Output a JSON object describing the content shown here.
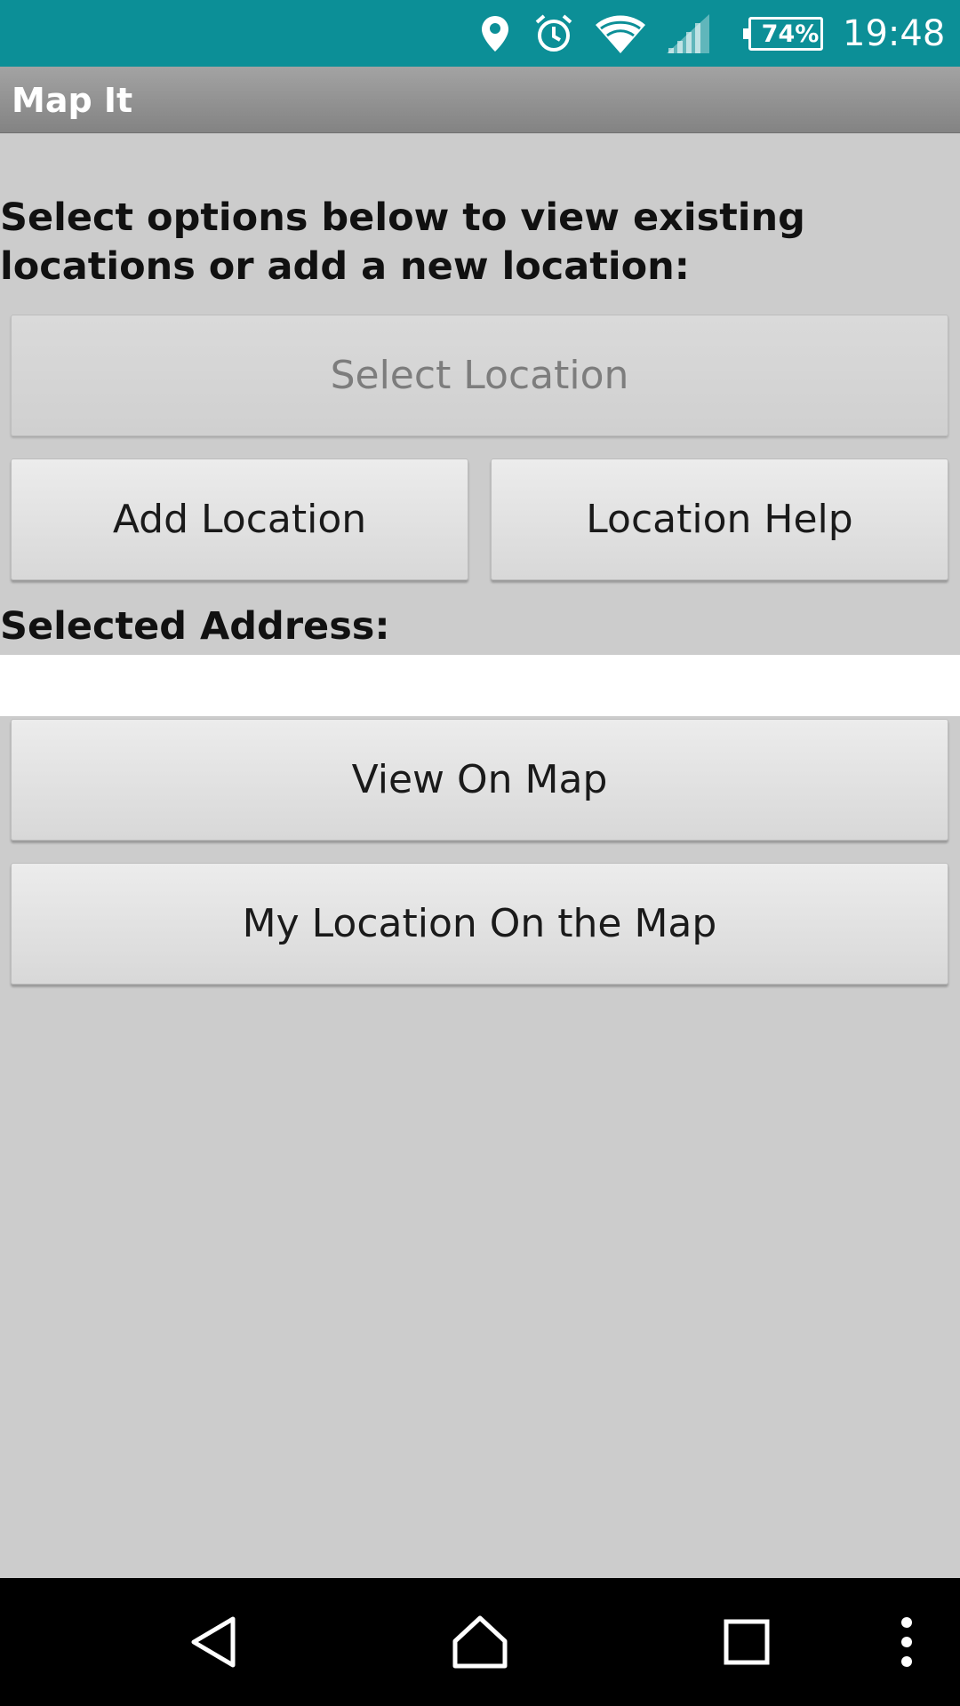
{
  "status_bar": {
    "icons": [
      "location-pin-icon",
      "alarm-icon",
      "wifi-icon",
      "cell-signal-icon",
      "battery-icon"
    ],
    "battery_percent": "74%",
    "time": "19:48",
    "color": "#0c8f97"
  },
  "app": {
    "title": "Map It"
  },
  "main": {
    "intro_text": "Select options below to view existing locations or add a new location:",
    "select_location_label": "Select Location",
    "add_location_label": "Add Location",
    "location_help_label": "Location Help",
    "selected_address_label": "Selected Address:",
    "selected_address_value": "",
    "view_on_map_label": "View On Map",
    "my_location_label": "My Location On the Map"
  },
  "nav_bar": {
    "icons": [
      "back-icon",
      "home-icon",
      "recent-apps-icon",
      "overflow-menu-icon"
    ]
  }
}
